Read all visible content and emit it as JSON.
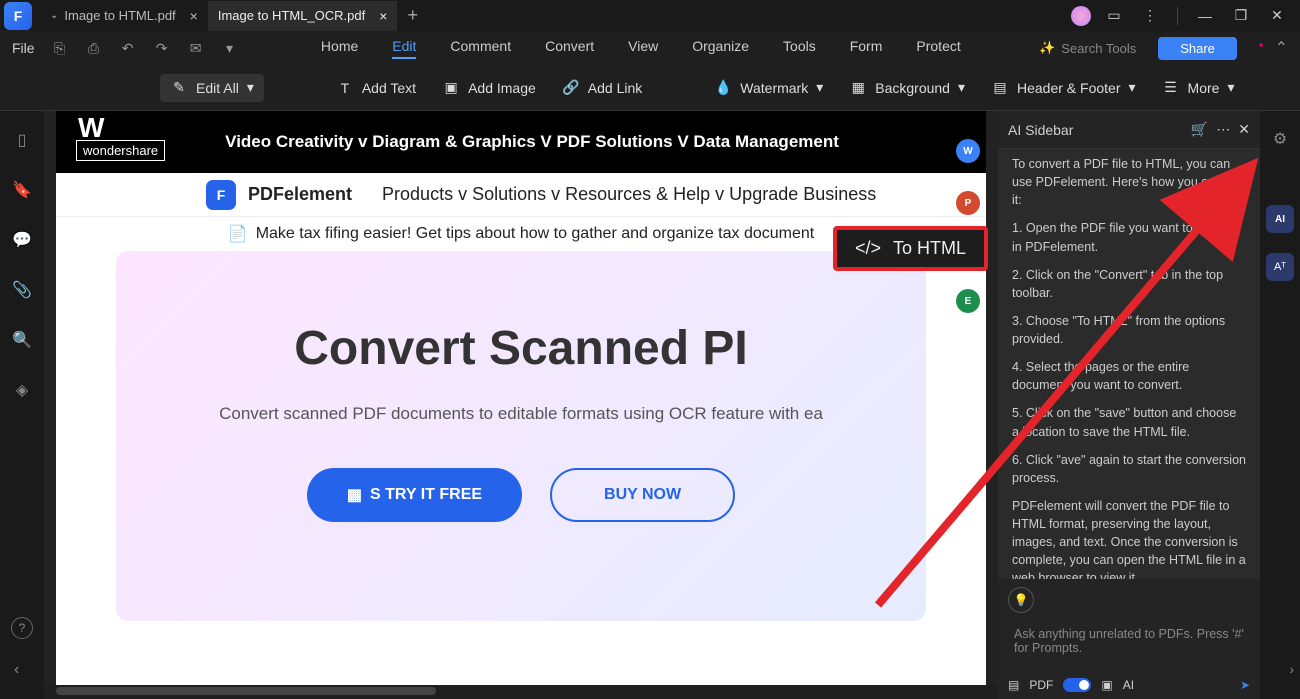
{
  "tabs": {
    "app_initial": "F",
    "inactive": "Image to HTML.pdf",
    "active": "Image to HTML_OCR.pdf"
  },
  "menu": {
    "file": "File",
    "items": [
      "Home",
      "Edit",
      "Comment",
      "Convert",
      "View",
      "Organize",
      "Tools",
      "Form",
      "Protect"
    ],
    "search_placeholder": "Search Tools",
    "share": "Share"
  },
  "toolbar": {
    "edit_all": "Edit All",
    "add_text": "Add Text",
    "add_image": "Add Image",
    "add_link": "Add Link",
    "watermark": "Watermark",
    "background": "Background",
    "header_footer": "Header & Footer",
    "more": "More"
  },
  "page": {
    "brand_initial": "W",
    "brand": "wondershare",
    "black_links": "Video Creativity v Diagram & Graphics V      PDF Solutions V Data Management",
    "pdfe": "PDFelement",
    "nav": "Products v     Solutions v Resources & Help v Upgrade Business",
    "to_html": "To HTML",
    "tip": "Make tax fifing easier! Get tips about how to gather and organize tax document",
    "hero_title": "Convert Scanned PI",
    "hero_sub": "Convert scanned PDF documents to editable formats using OCR feature with ea",
    "btn_try": "S TRY IT FREE",
    "btn_buy": "BUY NOW"
  },
  "sidebar": {
    "title": "AI Sidebar",
    "intro": "To convert a PDF file to HTML, you can use PDFelement. Here's how you can do it:",
    "step1": "1. Open the PDF file you want to convert in PDFelement.",
    "step2": "2. Click on the \"Convert\" tab in the top toolbar.",
    "step3": "3. Choose \"To HTML\" from the options provided.",
    "step4": "4. Select the pages or the entire document you want to convert.",
    "step5": "5. Click on the \"save\" button and choose a location to save the HTML file.",
    "step6": "6. Click \"ave\" again to start the conversion process.",
    "outro": "PDFelement will convert the PDF file to HTML format, preserving the layout, images, and text. Once the conversion is complete, you can open the HTML file in a web browser to view it.",
    "input_placeholder": "Ask anything unrelated to PDFs. Press '#' for Prompts.",
    "pdf_badge": "PDF",
    "ai_badge": "AI"
  }
}
